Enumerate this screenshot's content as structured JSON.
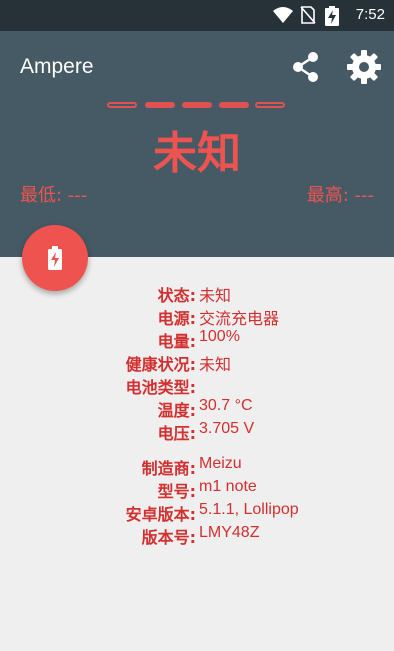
{
  "status_bar": {
    "time": "7:52"
  },
  "app": {
    "title": "Ampere"
  },
  "icons": {
    "share": "share-icon",
    "settings": "gear-icon",
    "battery": "battery-charging-icon"
  },
  "colors": {
    "header": "#455a64",
    "status_bar": "#263238",
    "accent": "#ef5350",
    "text_red": "#d32f2f",
    "background": "#efefef"
  },
  "meter": {
    "active_dashes": 3,
    "total_dashes": 5
  },
  "current": {
    "value": "未知"
  },
  "range": {
    "min_label": "最低: ---",
    "max_label": "最高: ---"
  },
  "battery_info": [
    {
      "label": "状态:",
      "value": "未知"
    },
    {
      "label": "电源:",
      "value": "交流充电器"
    },
    {
      "label": "电量:",
      "value": "100%"
    },
    {
      "label": "健康状况:",
      "value": "未知"
    },
    {
      "label": "电池类型:",
      "value": ""
    },
    {
      "label": "温度:",
      "value": "30.7 °C"
    },
    {
      "label": "电压:",
      "value": "3.705 V"
    }
  ],
  "device_info": [
    {
      "label": "制造商:",
      "value": "Meizu"
    },
    {
      "label": "型号:",
      "value": "m1 note"
    },
    {
      "label": "安卓版本:",
      "value": "5.1.1, Lollipop"
    },
    {
      "label": "版本号:",
      "value": "LMY48Z"
    }
  ]
}
